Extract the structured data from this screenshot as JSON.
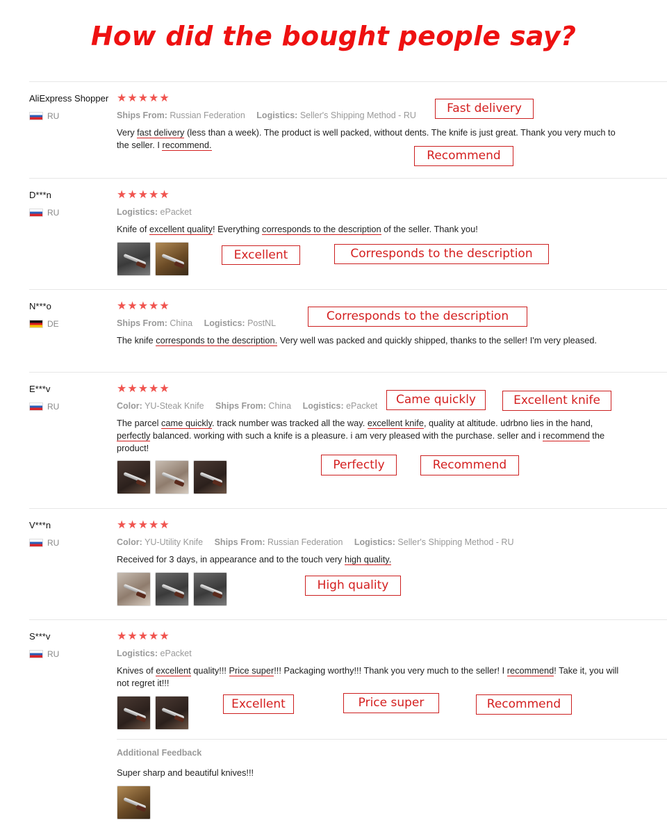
{
  "page_title": "How did the bought people say?",
  "rating_stars": "★★★★★",
  "colors": {
    "accent_red": "#ee1111",
    "star": "#f0544f",
    "muted": "#999999"
  },
  "icons": {
    "star": "star-icon",
    "flag_ru": "russia-flag-icon",
    "flag_de": "germany-flag-icon"
  },
  "reviews": [
    {
      "reviewer": "AliExpress Shopper",
      "country": "RU",
      "ships_from_label": "Ships From:",
      "ships_from": "Russian Federation",
      "logistics_label": "Logistics:",
      "logistics": "Seller's Shipping Method - RU",
      "text": [
        "Very ",
        "fast delivery",
        " (less than a week). The product is well packed, without dents. The knife is just great. Thank you very much to the seller. I ",
        "recommend.",
        ""
      ],
      "callouts": [
        "Fast delivery",
        "Recommend"
      ]
    },
    {
      "reviewer": "D***n",
      "country": "RU",
      "logistics_label": "Logistics:",
      "logistics": "ePacket",
      "text": [
        "Knife of ",
        "excellent quality",
        "! Everything ",
        "corresponds to the description",
        " of the seller. Thank you!"
      ],
      "callouts": [
        "Excellent",
        "Corresponds to the description"
      ]
    },
    {
      "reviewer": "N***o",
      "country": "DE",
      "ships_from_label": "Ships From:",
      "ships_from": "China",
      "logistics_label": "Logistics:",
      "logistics": "PostNL",
      "text": [
        "The knife ",
        "corresponds to the description.",
        " Very well was packed and quickly shipped, thanks to the seller! I'm very pleased.",
        "",
        ""
      ],
      "callouts": [
        "Corresponds to the description"
      ]
    },
    {
      "reviewer": "E***v",
      "country": "RU",
      "color_label": "Color:",
      "color": "YU-Steak Knife",
      "ships_from_label": "Ships From:",
      "ships_from": "China",
      "logistics_label": "Logistics:",
      "logistics": "ePacket",
      "text": [
        "The parcel ",
        "came quickly",
        ". track number was tracked all the way. ",
        "excellent knife",
        ", quality at altitude. udrbno lies in the hand, ",
        "perfectly",
        " balanced. working with such a knife is a pleasure. i am very pleased with the purchase. seller and i ",
        "recommend",
        " the product!"
      ],
      "callouts": [
        "Came quickly",
        "Excellent knife",
        "Perfectly",
        "Recommend"
      ]
    },
    {
      "reviewer": "V***n",
      "country": "RU",
      "color_label": "Color:",
      "color": "YU-Utility Knife",
      "ships_from_label": "Ships From:",
      "ships_from": "Russian Federation",
      "logistics_label": "Logistics:",
      "logistics": "Seller's Shipping Method - RU",
      "text": [
        "Received for 3 days, in appearance and to the touch very ",
        "high quality.",
        "",
        "",
        ""
      ],
      "callouts": [
        "High quality"
      ]
    },
    {
      "reviewer": "S***v",
      "country": "RU",
      "logistics_label": "Logistics:",
      "logistics": "ePacket",
      "text": [
        "Knives of ",
        "excellent",
        " quality!!! ",
        "Price super",
        "!!! Packaging worthy!!! Thank you very much to the seller! I ",
        "recommend",
        "! Take it, you will not regret it!!!"
      ],
      "callouts": [
        "Excellent",
        "Price super",
        "Recommend"
      ]
    }
  ],
  "additional_feedback": {
    "heading": "Additional Feedback",
    "text": "Super sharp and beautiful knives!!!"
  }
}
